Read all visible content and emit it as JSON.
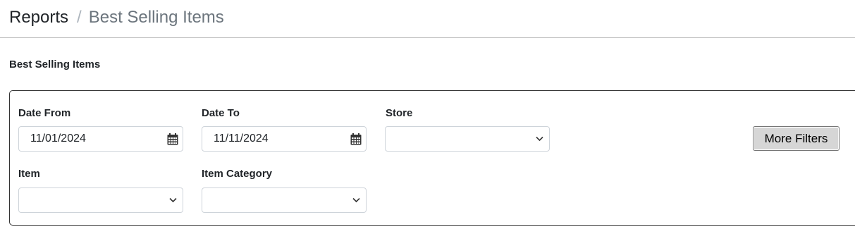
{
  "breadcrumb": {
    "root": "Reports",
    "separator": "/",
    "current": "Best Selling Items"
  },
  "section": {
    "title": "Best Selling Items"
  },
  "filters": {
    "date_from": {
      "label": "Date From",
      "value": "11/01/2024",
      "icon": "calendar-icon"
    },
    "date_to": {
      "label": "Date To",
      "value": "11/11/2024",
      "icon": "calendar-icon"
    },
    "store": {
      "label": "Store",
      "value": "",
      "icon": "chevron-down-icon"
    },
    "item": {
      "label": "Item",
      "value": "",
      "icon": "chevron-down-icon"
    },
    "item_category": {
      "label": "Item Category",
      "value": "",
      "icon": "chevron-down-icon"
    },
    "more_filters_label": "More Filters"
  },
  "colors": {
    "text": "#212529",
    "muted": "#6c757d",
    "border": "#ced4da",
    "card_border": "#333333",
    "button_bg": "#d6d6d6"
  }
}
